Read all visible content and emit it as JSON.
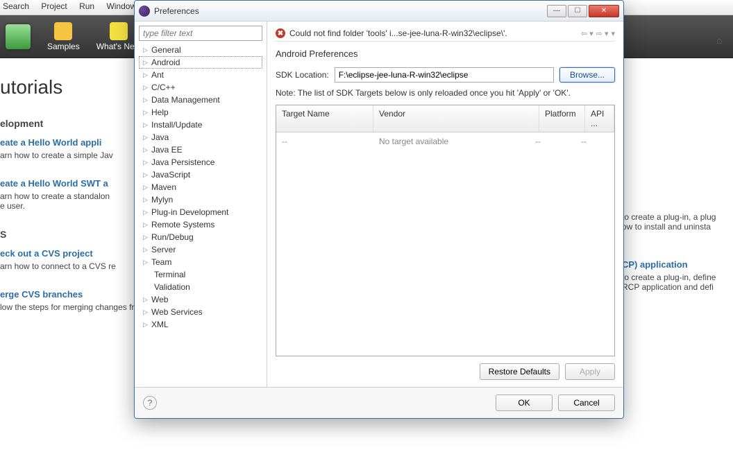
{
  "bg_menu": {
    "items": [
      "Search",
      "Project",
      "Run",
      "Window"
    ]
  },
  "bg_toolbar": {
    "samples": "Samples",
    "whatsnew": "What's New"
  },
  "bg": {
    "title": "utorials",
    "sec1": "elopment",
    "l1": "eate a Hello World appli",
    "d1": "arn how to create a simple Jav",
    "l2": "eate a Hello World SWT a",
    "d2a": "arn how to create a standalon",
    "d2b": "e user.",
    "sec2": "S",
    "l3": "eck out a CVS project",
    "d3": "arn how to connect to a CVS re",
    "l4": "erge CVS branches",
    "d4": "low the steps for merging changes from one CVS branch into another.",
    "r1": "to create a plug-in, a plug",
    "r2": "ow to install and uninsta",
    "rl": "CP) application",
    "r3": "to create a plug-in, define",
    "r4": " RCP application and defi"
  },
  "dialog": {
    "title": "Preferences",
    "filter_placeholder": "type filter text",
    "tree": [
      "General",
      "Android",
      "Ant",
      "C/C++",
      "Data Management",
      "Help",
      "Install/Update",
      "Java",
      "Java EE",
      "Java Persistence",
      "JavaScript",
      "Maven",
      "Mylyn",
      "Plug-in Development",
      "Remote Systems",
      "Run/Debug",
      "Server",
      "Team",
      "Terminal",
      "Validation",
      "Web",
      "Web Services",
      "XML"
    ],
    "selected_index": 1,
    "error": "Could not find folder 'tools' i...se-jee-luna-R-win32\\eclipse\\'.",
    "heading": "Android Preferences",
    "sdk_label": "SDK Location:",
    "sdk_value": "F:\\eclipse-jee-luna-R-win32\\eclipse",
    "browse": "Browse...",
    "note": "Note: The list of SDK Targets below is only reloaded once you hit 'Apply' or 'OK'.",
    "table_headers": {
      "c1": "Target Name",
      "c2": "Vendor",
      "c3": "Platform",
      "c4": "API ..."
    },
    "table_row": {
      "c1": "--",
      "c2": "No target available",
      "c3": "--",
      "c4": "--"
    },
    "restore": "Restore Defaults",
    "apply": "Apply",
    "ok": "OK",
    "cancel": "Cancel"
  }
}
